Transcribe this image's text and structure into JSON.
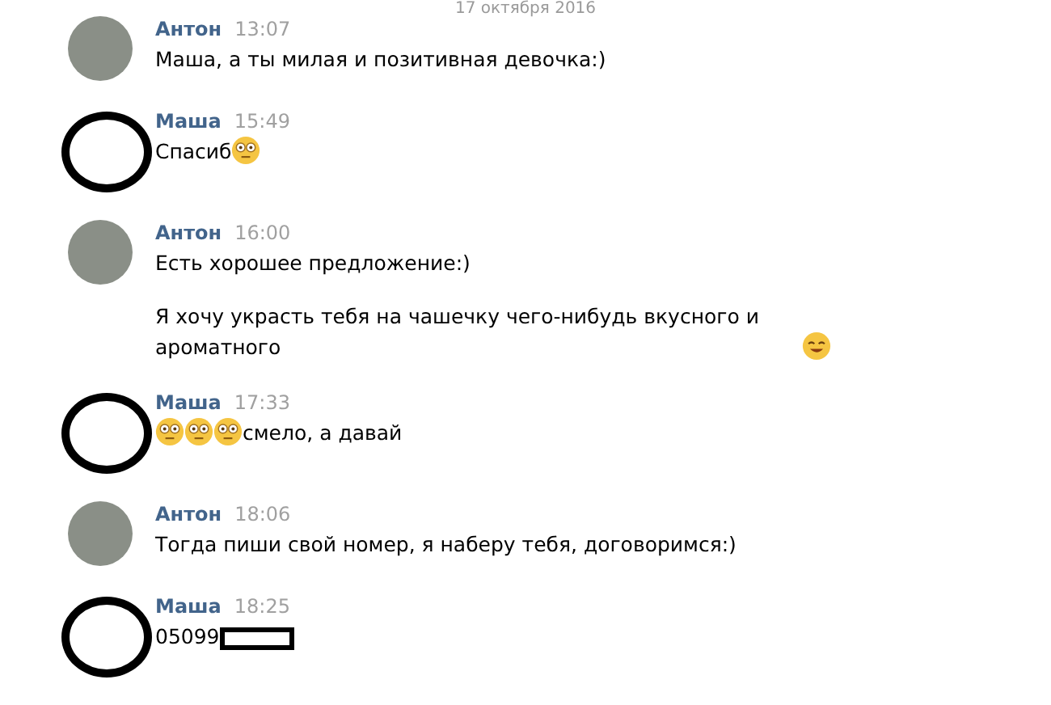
{
  "date": "17 октября 2016",
  "messages": [
    {
      "author": "Антон",
      "time": "13:07",
      "avatar": {
        "kind": "photo"
      },
      "paragraphs": [
        [
          {
            "kind": "text",
            "text": "Маша, а ты милая и позитивная девочка:)"
          }
        ]
      ]
    },
    {
      "author": "Маша",
      "time": "15:49",
      "avatar": {
        "kind": "ring"
      },
      "paragraphs": [
        [
          {
            "kind": "text",
            "text": "Спасиб "
          },
          {
            "kind": "emoji-flushed"
          }
        ]
      ]
    },
    {
      "author": "Антон",
      "time": "16:00",
      "avatar": {
        "kind": "photo"
      },
      "paragraphs": [
        [
          {
            "kind": "text",
            "text": "Есть хорошее предложение:)"
          }
        ],
        [
          {
            "kind": "text",
            "text": "Я хочу украсть тебя на чашечку чего-нибудь вкусного и ароматного"
          },
          {
            "kind": "emoji-smile"
          }
        ]
      ]
    },
    {
      "author": "Маша",
      "time": "17:33",
      "avatar": {
        "kind": "ring"
      },
      "paragraphs": [
        [
          {
            "kind": "emoji-flushed"
          },
          {
            "kind": "emoji-flushed"
          },
          {
            "kind": "emoji-flushed"
          },
          {
            "kind": "text",
            "text": "смело, а давай"
          }
        ]
      ]
    },
    {
      "author": "Антон",
      "time": "18:06",
      "avatar": {
        "kind": "photo"
      },
      "paragraphs": [
        [
          {
            "kind": "text",
            "text": "Тогда пиши свой номер, я наберу тебя, договоримся:)"
          }
        ]
      ]
    },
    {
      "author": "Маша",
      "time": "18:25",
      "avatar": {
        "kind": "ring"
      },
      "paragraphs": [
        [
          {
            "kind": "text",
            "text": "05099"
          },
          {
            "kind": "redaction"
          }
        ]
      ]
    }
  ]
}
